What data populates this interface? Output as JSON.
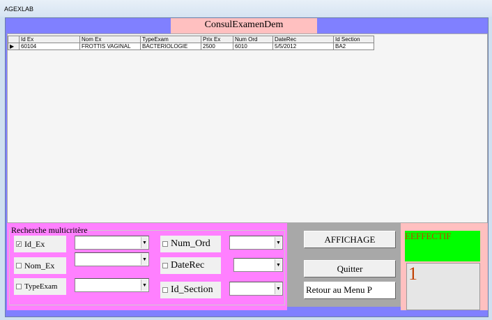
{
  "window": {
    "title": "AGEXLAB"
  },
  "form": {
    "title": "ConsulExamenDem"
  },
  "grid": {
    "columns": [
      "Id Ex",
      "Nom Ex",
      "TypeExam",
      "Prix Ex",
      "Num Ord",
      "DateRec",
      "Id Section"
    ],
    "rows": [
      [
        "60104",
        "FROTTIS VAGINAL",
        "BACTERIOLOGIE",
        "2500",
        "6010",
        "5/5/2012",
        "BA2"
      ]
    ]
  },
  "search": {
    "legend": "Recherche multicritère",
    "criteria": [
      {
        "label": "Id_Ex",
        "checked": true
      },
      {
        "label": "Nom_Ex",
        "checked": false
      },
      {
        "label": "TypeExam",
        "checked": false
      },
      {
        "label": "Num_Ord",
        "checked": false
      },
      {
        "label": "DateRec",
        "checked": false
      },
      {
        "label": "Id_Section",
        "checked": false
      }
    ],
    "check_mark": "✓"
  },
  "buttons": {
    "affichage": "AFFICHAGE",
    "quitter": "Quitter",
    "retour": "Retour au  Menu P"
  },
  "effectif": {
    "label": "EEFFECTIF",
    "value": "1"
  }
}
